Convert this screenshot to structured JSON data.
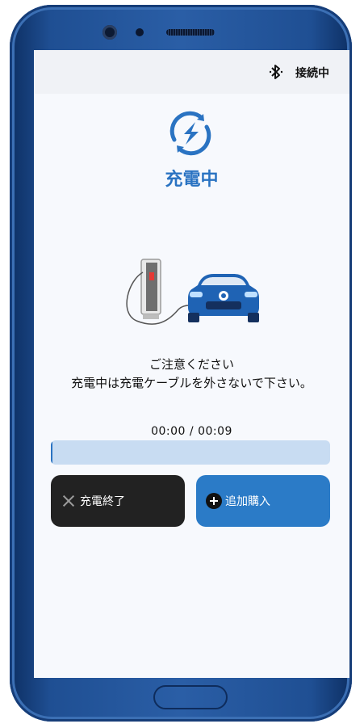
{
  "status": {
    "connection_label": "接続中"
  },
  "header": {
    "title": "充電中"
  },
  "notice": {
    "line1": "ご注意ください",
    "line2": "充電中は充電ケーブルを外さないで下さい。"
  },
  "progress": {
    "elapsed": "00:00",
    "total": "00:09",
    "separator": " / ",
    "fraction": 0.005
  },
  "actions": {
    "end_label": "充電終了",
    "add_label": "追加購入"
  },
  "colors": {
    "accent": "#2a73c2",
    "progress_track": "#c8dcf2",
    "end_button": "#222222",
    "add_button": "#2b7bc7"
  }
}
